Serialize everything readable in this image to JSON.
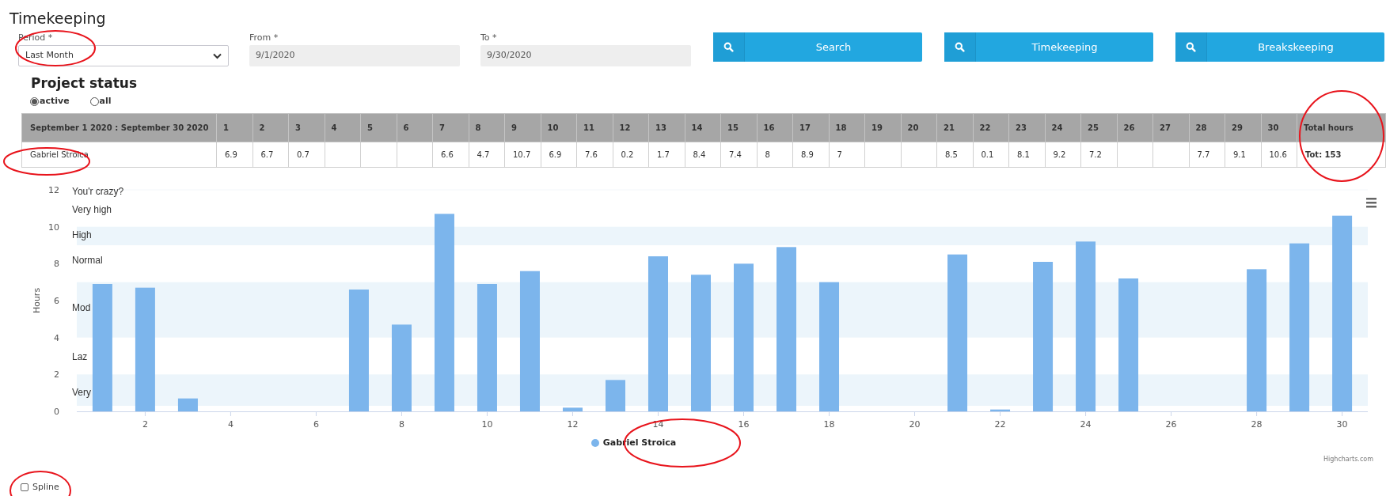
{
  "page_title": "Timekeeping",
  "filters": [
    {
      "kind": "select",
      "label": "Period *",
      "value": "Last Month",
      "disabled": false
    },
    {
      "kind": "text",
      "label": "From *",
      "value": "9/1/2020",
      "disabled": true
    },
    {
      "kind": "text",
      "label": "To *",
      "value": "9/30/2020",
      "disabled": true
    }
  ],
  "buttons": [
    "Search",
    "Timekeeping",
    "Breakskeeping"
  ],
  "project_status": {
    "title": "Project status",
    "options": [
      {
        "label": "active",
        "selected": true
      },
      {
        "label": "all",
        "selected": false
      }
    ]
  },
  "table": {
    "columns": [
      "September 1 2020 : September 30 2020",
      "1",
      "2",
      "3",
      "4",
      "5",
      "6",
      "7",
      "8",
      "9",
      "10",
      "11",
      "12",
      "13",
      "14",
      "15",
      "16",
      "17",
      "18",
      "19",
      "20",
      "21",
      "22",
      "23",
      "24",
      "25",
      "26",
      "27",
      "28",
      "29",
      "30",
      "Total hours"
    ],
    "rows": [
      {
        "cells": [
          "Gabriel Stroica",
          "6.9",
          "6.7",
          "0.7",
          null,
          null,
          null,
          "6.6",
          "4.7",
          "10.7",
          "6.9",
          "7.6",
          "0.2",
          "1.7",
          "8.4",
          "7.4",
          "8",
          "8.9",
          "7",
          null,
          null,
          "8.5",
          "0.1",
          "8.1",
          "9.2",
          "7.2",
          null,
          null,
          "7.7",
          "9.1",
          "10.6",
          "Tot: 153"
        ]
      }
    ]
  },
  "chart": {
    "plot_bands": [
      {
        "label": "You'r crazy?",
        "shaded": false
      },
      {
        "label": "Very high",
        "shaded": false
      },
      {
        "label": "High",
        "shaded": true
      },
      {
        "label": "Normal",
        "shaded": false
      },
      {
        "label": "Mod",
        "shaded": true
      },
      {
        "label": "Laz",
        "shaded": false
      },
      {
        "label": "Very",
        "shaded": true
      }
    ],
    "chart_data": {
      "type": "bar",
      "ylabel": "Hours",
      "x": [
        1,
        2,
        3,
        4,
        5,
        6,
        7,
        8,
        9,
        10,
        11,
        12,
        13,
        14,
        15,
        16,
        17,
        18,
        19,
        20,
        21,
        22,
        23,
        24,
        25,
        26,
        27,
        28,
        29,
        30
      ],
      "series": [
        {
          "name": "Gabriel Stroica",
          "color": "#7cb5ec",
          "values": [
            6.9,
            6.7,
            0.7,
            null,
            null,
            null,
            6.6,
            4.7,
            10.7,
            6.9,
            7.6,
            0.2,
            1.7,
            8.4,
            7.4,
            8,
            8.9,
            7,
            null,
            null,
            8.5,
            0.1,
            8.1,
            9.2,
            7.2,
            null,
            null,
            7.7,
            9.1,
            10.6
          ]
        }
      ],
      "xlim": [
        0.4,
        30.6
      ],
      "ylim": [
        0,
        12
      ],
      "xticks": [
        {
          "value": 2,
          "label": "2"
        },
        {
          "value": 4,
          "label": "4"
        },
        {
          "value": 6,
          "label": "6"
        },
        {
          "value": 8,
          "label": "8"
        },
        {
          "value": 10,
          "label": "10"
        },
        {
          "value": 12,
          "label": "12"
        },
        {
          "value": 14,
          "label": "14"
        },
        {
          "value": 16,
          "label": "16"
        },
        {
          "value": 18,
          "label": "18"
        },
        {
          "value": 20,
          "label": "20"
        },
        {
          "value": 22,
          "label": "22"
        },
        {
          "value": 24,
          "label": "24"
        },
        {
          "value": 26,
          "label": "26"
        },
        {
          "value": 28,
          "label": "28"
        },
        {
          "value": 30,
          "label": "30"
        }
      ],
      "yticks": [
        {
          "value": 0,
          "label": "0"
        },
        {
          "value": 2,
          "label": "2"
        },
        {
          "value": 4,
          "label": "4"
        },
        {
          "value": 6,
          "label": "6"
        },
        {
          "value": 8,
          "label": "8"
        },
        {
          "value": 10,
          "label": "10"
        },
        {
          "value": 12,
          "label": "12"
        }
      ]
    },
    "credit": "Highcharts.com"
  },
  "spline": {
    "label": "Spline",
    "checked": false
  }
}
